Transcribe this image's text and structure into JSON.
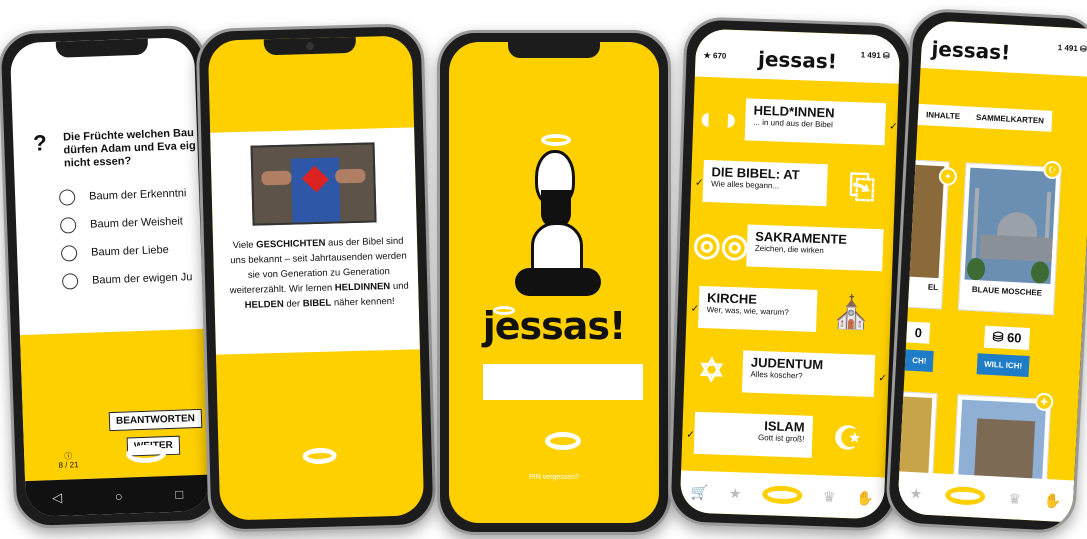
{
  "screens": {
    "quiz": {
      "question_lines": [
        "Die Früchte welchen Bau",
        "dürfen Adam und Eva eig",
        "nicht essen?"
      ],
      "answers": [
        "Baum der Erkenntni",
        "Baum der Weisheit",
        "Baum der Liebe",
        "Baum der ewigen Ju"
      ],
      "submit_label": "BEANTWORTEN",
      "next_label": "WEITER",
      "progress": "8 / 21",
      "nav": [
        "◁",
        "○",
        "□"
      ]
    },
    "intro": {
      "story_parts": [
        "Viele ",
        "GESCHICHTEN",
        " aus der Bibel sind uns bekannt – seit Jahrtausenden werden sie von Generation zu Generation weitererzählt. Wir lernen ",
        "HELDINNEN",
        " und ",
        "HELDEN",
        " der ",
        "BIBEL",
        " näher kennen!"
      ]
    },
    "login": {
      "brand": "jessas!",
      "forgot_pin": "PIN vergessen?"
    },
    "categories": {
      "brand": "jessas!",
      "stars": "670",
      "coins": "1 491",
      "items": [
        {
          "title": "HELD*INNEN",
          "subtitle": "... in und aus der Bibel"
        },
        {
          "title": "DIE BIBEL: AT",
          "subtitle": "Wie alles begann..."
        },
        {
          "title": "SAKRAMENTE",
          "subtitle": "Zeichen, die wirken"
        },
        {
          "title": "KIRCHE",
          "subtitle": "Wer, was, wie, warum?"
        },
        {
          "title": "JUDENTUM",
          "subtitle": "Alles koscher?"
        },
        {
          "title": "ISLAM",
          "subtitle": "Gott ist groß!"
        }
      ],
      "icons": [
        "cart-icon",
        "star-icon",
        "halo-icon",
        "trophy-icon",
        "hand-icon"
      ]
    },
    "shop": {
      "brand": "jessas!",
      "coins": "1 491",
      "tab_left": "INHALTE",
      "tab_right": "SAMMELKARTEN",
      "card_left_label": "EL",
      "card_right_label": "BLAUE MOSCHEE",
      "price_left": "0",
      "price_right": "60",
      "buy_left": "CH!",
      "buy_right": "WILL ICH!"
    }
  },
  "colors": {
    "brand_yellow": "#ffd000",
    "buy_blue": "#1f7cc7"
  }
}
